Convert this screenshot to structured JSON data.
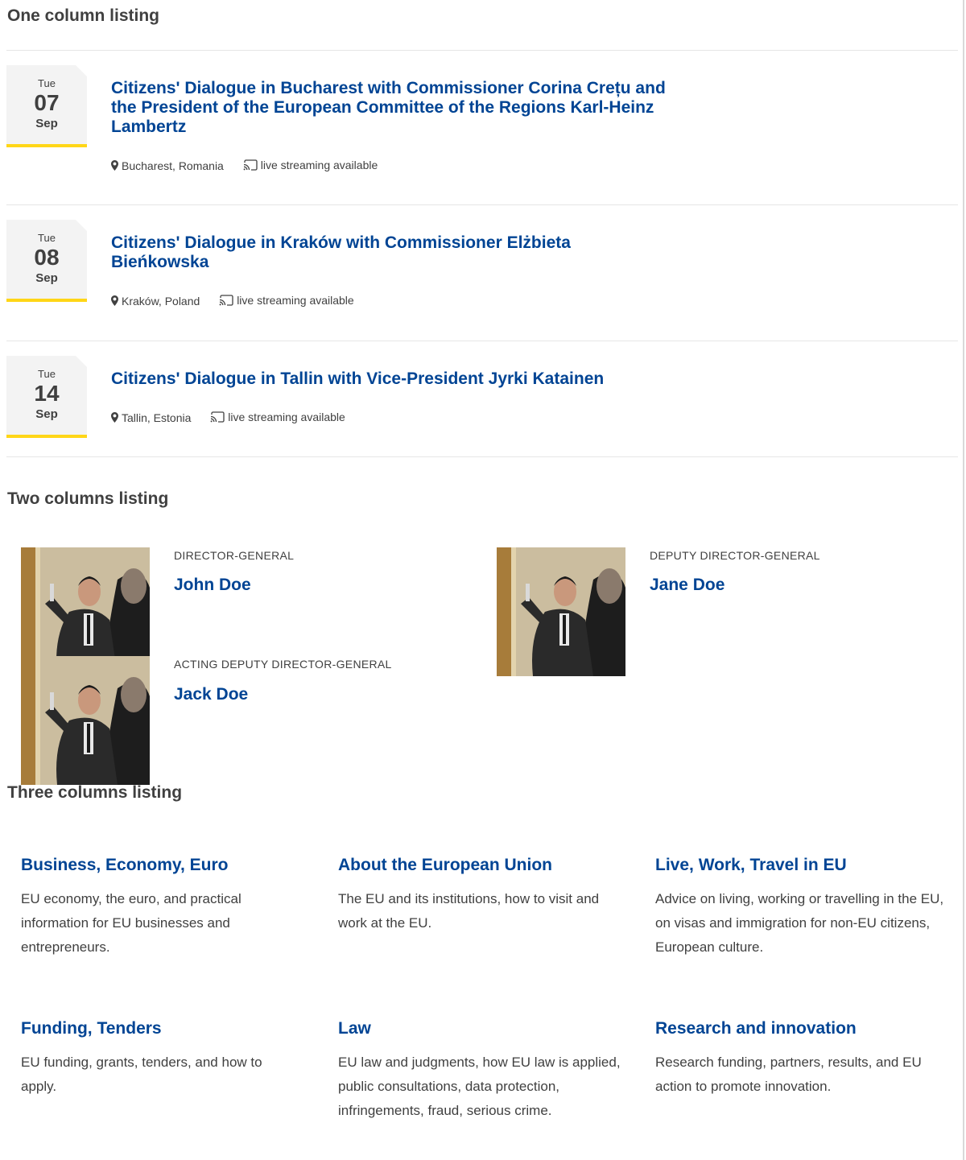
{
  "one_column": {
    "title": "One column listing",
    "events": [
      {
        "weekday": "Tue",
        "day": "07",
        "month": "Sep",
        "title": "Citizens' Dialogue in Bucharest with Commissioner Corina Crețu and the President of the European Committee of the Regions Karl-Heinz Lambertz",
        "location": "Bucharest, Romania",
        "streaming": "live streaming available"
      },
      {
        "weekday": "Tue",
        "day": "08",
        "month": "Sep",
        "title": "Citizens' Dialogue in Kraków with Commissioner Elżbieta Bieńkowska",
        "location": "Kraków, Poland",
        "streaming": "live streaming available"
      },
      {
        "weekday": "Tue",
        "day": "14",
        "month": "Sep",
        "title": "Citizens' Dialogue in Tallin with Vice-President Jyrki Katainen",
        "location": "Tallin, Estonia",
        "streaming": "live streaming available"
      }
    ],
    "icons": {
      "location": "map-marker-icon",
      "streaming": "cast-icon"
    }
  },
  "two_columns": {
    "title": "Two columns listing",
    "people": [
      {
        "role": "Director-General",
        "name": "John Doe"
      },
      {
        "role": "Acting Deputy Director-General",
        "name": "Jack Doe"
      },
      {
        "role": "Deputy Director-General",
        "name": "Jane Doe"
      }
    ]
  },
  "three_columns": {
    "title": "Three columns listing",
    "topics": [
      {
        "title": "Business, Economy, Euro",
        "description": "EU economy, the euro, and practical information for EU businesses and entrepreneurs."
      },
      {
        "title": "About the European Union",
        "description": "The EU and its institutions, how to visit and work at the EU."
      },
      {
        "title": "Live, Work, Travel in EU",
        "description": "Advice on living, working or travelling in the EU, on visas and immigration for non-EU citizens, European culture."
      },
      {
        "title": "Funding, Tenders",
        "description": "EU funding, grants, tenders, and how to apply."
      },
      {
        "title": "Law",
        "description": "EU law and judgments, how EU law is applied, public consultations, data protection, infringements, fraud, serious crime."
      },
      {
        "title": "Research and innovation",
        "description": "Research funding, partners, results, and EU action to promote innovation."
      }
    ]
  },
  "colors": {
    "link": "#004494",
    "accent": "#ffd617",
    "text": "#404040",
    "date_bg": "#f3f3f3"
  }
}
